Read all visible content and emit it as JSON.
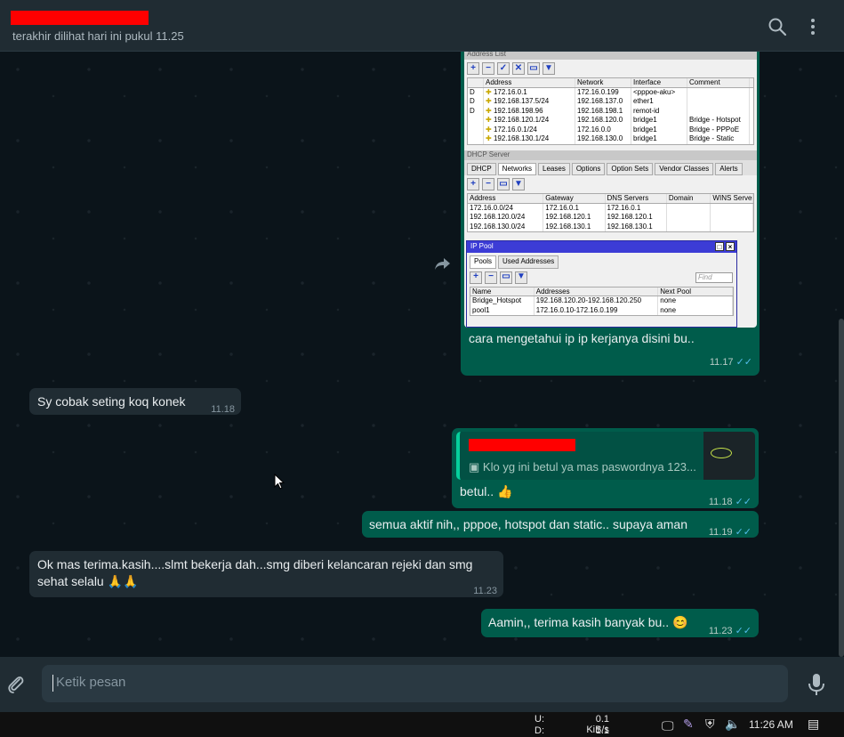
{
  "header": {
    "last_seen": "terakhir dilihat hari ini pukul 11.25",
    "search_icon": "search-icon",
    "menu_icon": "more-vertical-icon"
  },
  "messages": [
    {
      "type": "out",
      "caption": "cara mengetahui ip ip kerjanya disini bu..",
      "time": "11.17"
    },
    {
      "type": "in",
      "text": "Sy cobak seting koq konek",
      "time": "11.18"
    },
    {
      "type": "out",
      "quote_text": "Klo yg ini betul ya mas paswordnya 123...",
      "text": "betul.. 👍",
      "time": "11.18"
    },
    {
      "type": "out",
      "text": "semua aktif nih,, pppoe, hotspot dan static.. supaya aman",
      "time": "11.19"
    },
    {
      "type": "in",
      "text": "Ok mas terima.kasih....slmt bekerja dah...smg diberi kelancaran rejeki dan smg sehat selalu 🙏🙏",
      "time": "11.23"
    },
    {
      "type": "out",
      "text": "Aamin,, terima kasih banyak bu.. 😊",
      "time": "11.23"
    }
  ],
  "screenshot": {
    "address_list_title": "Address List",
    "address_headers": [
      "Address",
      "Network",
      "Interface",
      "Comment"
    ],
    "address_rows": [
      [
        "D",
        "172.16.0.1",
        "172.16.0.199",
        "<pppoe-aku>",
        ""
      ],
      [
        "D",
        "192.168.137.5/24",
        "192.168.137.0",
        "ether1",
        ""
      ],
      [
        "D",
        "192.168.198.96",
        "192.168.198.1",
        "remot-id",
        ""
      ],
      [
        "",
        "192.168.120.1/24",
        "192.168.120.0",
        "bridge1",
        "Bridge - Hotspot"
      ],
      [
        "",
        "172.16.0.1/24",
        "172.16.0.0",
        "bridge1",
        "Bridge - PPPoE"
      ],
      [
        "",
        "192.168.130.1/24",
        "192.168.130.0",
        "bridge1",
        "Bridge - Static"
      ]
    ],
    "dhcp_title": "DHCP Server",
    "dhcp_tabs": [
      "DHCP",
      "Networks",
      "Leases",
      "Options",
      "Option Sets",
      "Vendor Classes",
      "Alerts"
    ],
    "dhcp_headers": [
      "Address",
      "Gateway",
      "DNS Servers",
      "Domain",
      "WINS Servers"
    ],
    "dhcp_rows": [
      [
        "172.16.0.0/24",
        "172.16.0.1",
        "172.16.0.1",
        "",
        ""
      ],
      [
        "192.168.120.0/24",
        "192.168.120.1",
        "192.168.120.1",
        "",
        ""
      ],
      [
        "192.168.130.0/24",
        "192.168.130.1",
        "192.168.130.1",
        "",
        ""
      ]
    ],
    "pool_title": "IP Pool",
    "pool_tabs": [
      "Pools",
      "Used Addresses"
    ],
    "pool_find": "Find",
    "pool_headers": [
      "Name",
      "Addresses",
      "Next Pool"
    ],
    "pool_rows": [
      [
        "Bridge_Hotspot",
        "192.168.120.20-192.168.120.250",
        "none"
      ],
      [
        "pool1",
        "172.16.0.10-172.16.0.199",
        "none"
      ]
    ]
  },
  "composer": {
    "placeholder": "Ketik pesan"
  },
  "taskbar": {
    "up_label": "U:",
    "down_label": "D:",
    "up_rate": "0.1 KiB/s",
    "down_rate": "1.1 KiB/s",
    "clock": "11:26 AM"
  },
  "colors": {
    "outgoing": "#005c4b",
    "incoming": "#202c33",
    "ticks": "#53bdeb",
    "redaction": "#ff0000"
  }
}
